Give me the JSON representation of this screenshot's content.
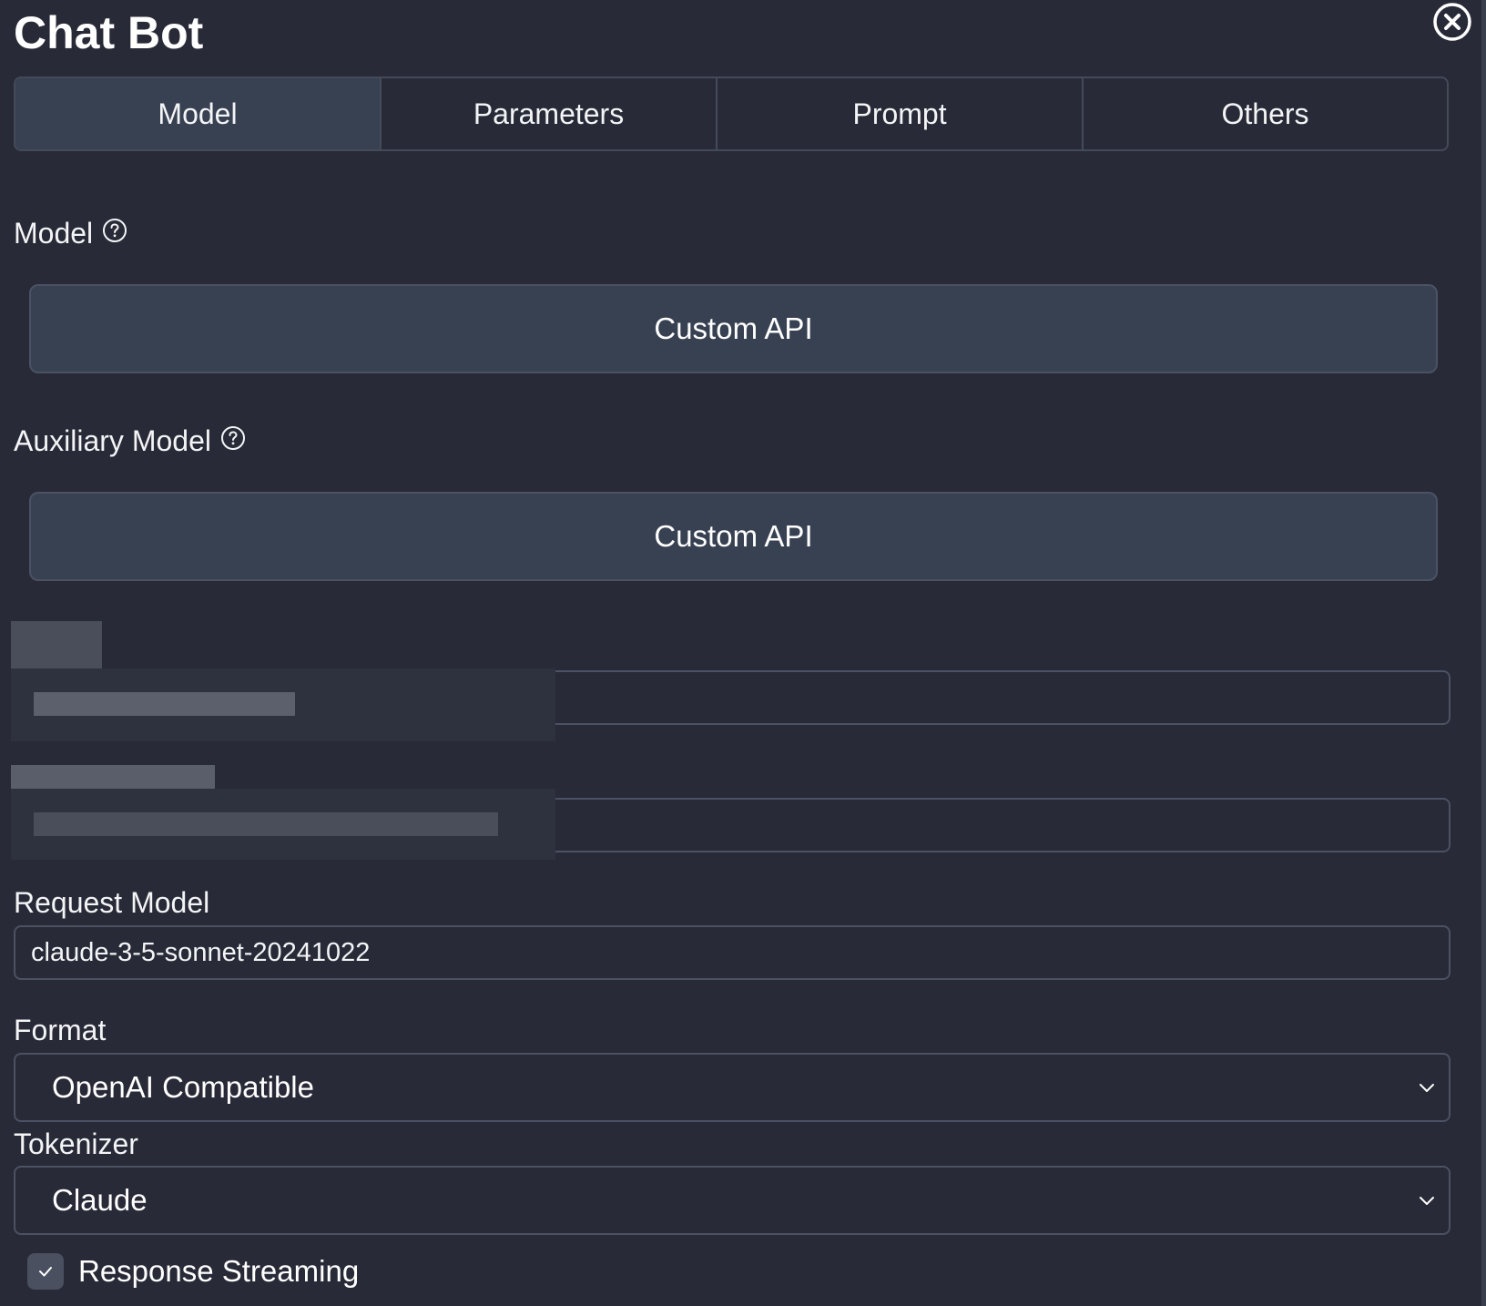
{
  "header": {
    "title": "Chat Bot"
  },
  "tabs": [
    {
      "label": "Model",
      "active": true
    },
    {
      "label": "Parameters",
      "active": false
    },
    {
      "label": "Prompt",
      "active": false
    },
    {
      "label": "Others",
      "active": false
    }
  ],
  "model": {
    "label": "Model",
    "value": "Custom API"
  },
  "auxiliary_model": {
    "label": "Auxiliary Model",
    "value": "Custom API"
  },
  "request_model": {
    "label": "Request Model",
    "value": "claude-3-5-sonnet-20241022"
  },
  "format": {
    "label": "Format",
    "selected": "OpenAI Compatible"
  },
  "tokenizer": {
    "label": "Tokenizer",
    "selected": "Claude"
  },
  "response_streaming": {
    "label": "Response Streaming",
    "checked": true
  },
  "icons": {
    "close": "close-circle-icon",
    "help": "question-circle-icon",
    "chevron": "chevron-down-icon",
    "check": "check-icon"
  },
  "colors": {
    "background": "#282a37",
    "panel": "#374151",
    "border": "#4b5263"
  }
}
